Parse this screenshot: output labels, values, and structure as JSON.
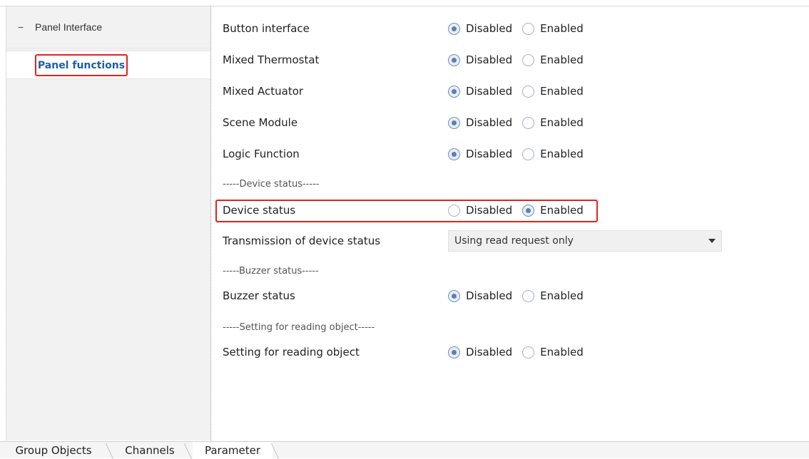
{
  "sidebar": {
    "group_label": "Panel Interface",
    "group_toggle": "−",
    "selected_item": "Panel functions"
  },
  "params": {
    "radio_labels": {
      "disabled": "Disabled",
      "enabled": "Enabled"
    },
    "rows": [
      {
        "label": "Button interface",
        "value": "Disabled"
      },
      {
        "label": "Mixed Thermostat",
        "value": "Disabled"
      },
      {
        "label": "Mixed Actuator",
        "value": "Disabled"
      },
      {
        "label": "Scene Module",
        "value": "Disabled"
      },
      {
        "label": "Logic Function",
        "value": "Disabled"
      }
    ],
    "separator_device": "-----Device status-----",
    "device_status": {
      "label": "Device status",
      "value": "Enabled"
    },
    "transmission": {
      "label": "Transmission of device status",
      "value": "Using read request only"
    },
    "separator_buzzer": "-----Buzzer  status-----",
    "buzzer_status": {
      "label": "Buzzer status",
      "value": "Disabled"
    },
    "separator_reading": "-----Setting for reading object-----",
    "reading_object": {
      "label": "Setting for reading object",
      "value": "Disabled"
    }
  },
  "tabs": [
    {
      "label": "Group Objects",
      "active": false
    },
    {
      "label": "Channels",
      "active": false
    },
    {
      "label": "Parameter",
      "active": true
    }
  ],
  "colors": {
    "highlight": "#e0241b",
    "link": "#1f5fa8",
    "radio_on": "#5e7fb0"
  }
}
